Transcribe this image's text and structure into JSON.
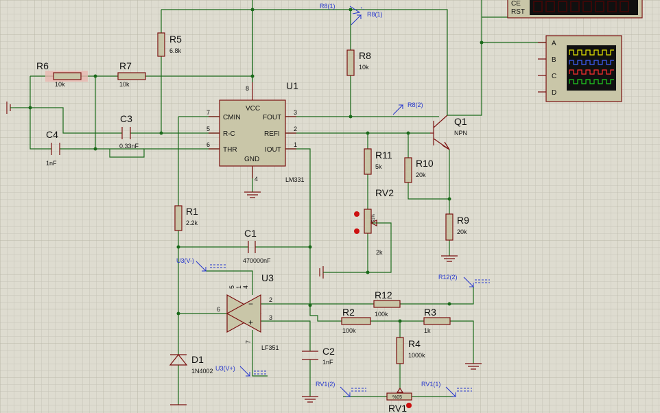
{
  "components": {
    "R5": {
      "ref": "R5",
      "value": "6.8k"
    },
    "R6": {
      "ref": "R6",
      "value": "10k"
    },
    "R7": {
      "ref": "R7",
      "value": "10k"
    },
    "R8": {
      "ref": "R8",
      "value": "10k"
    },
    "R1": {
      "ref": "R1",
      "value": "2.2k"
    },
    "R2": {
      "ref": "R2",
      "value": "100k"
    },
    "R3": {
      "ref": "R3",
      "value": "1k"
    },
    "R4": {
      "ref": "R4",
      "value": "1000k"
    },
    "R9": {
      "ref": "R9",
      "value": "20k"
    },
    "R10": {
      "ref": "R10",
      "value": "20k"
    },
    "R11": {
      "ref": "R11",
      "value": "5k"
    },
    "R12": {
      "ref": "R12",
      "value": "100k"
    },
    "C1": {
      "ref": "C1",
      "value": "470000nF"
    },
    "C2": {
      "ref": "C2",
      "value": "1nF"
    },
    "C3": {
      "ref": "C3",
      "value": "0.33nF"
    },
    "C4": {
      "ref": "C4",
      "value": "1nF"
    },
    "D1": {
      "ref": "D1",
      "value": "1N4002"
    },
    "Q1": {
      "ref": "Q1",
      "value": "NPN"
    },
    "RV2": {
      "ref": "RV2",
      "value": "2k",
      "setting": "51%"
    },
    "RV1": {
      "ref": "RV1",
      "setting": "%05"
    },
    "U1": {
      "ref": "U1",
      "part": "LM331",
      "pins": {
        "cmin": "CMIN",
        "rc": "R-C",
        "thr": "THR",
        "vcc": "VCC",
        "fout": "FOUT",
        "refi": "REFI",
        "iout": "IOUT",
        "gnd": "GND"
      },
      "pin_numbers": {
        "p7": "7",
        "p5": "5",
        "p6": "6",
        "p8": "8",
        "p3": "3",
        "p2": "2",
        "p1": "1",
        "p4": "4"
      }
    },
    "U3": {
      "ref": "U3",
      "part": "LF351",
      "pin_numbers": {
        "p6": "6",
        "p2": "2",
        "p3": "3",
        "p5": "5",
        "p1": "1",
        "p4": "4",
        "p7": "7"
      }
    }
  },
  "probes": {
    "r8_1_top": "R8(1)",
    "r8_1": "R8(1)",
    "r8_2": "R8(2)",
    "u3_vminus": "U3(V-)",
    "u3_vplus": "U3(V+)",
    "r12_2": "R12(2)",
    "rv1_2": "RV1(2)",
    "rv1_1": "RV1(1)"
  },
  "counter_pins": {
    "ce": "CE",
    "rst": "RST"
  },
  "oscilloscope": {
    "channels": [
      "A",
      "B",
      "C",
      "D"
    ],
    "trace_colors": [
      "#e8e800",
      "#4060ff",
      "#ff3030",
      "#20d020"
    ]
  },
  "colors": {
    "background": "#dedcd0",
    "grid": "#c7c5b7",
    "wire": "#1a6a1a",
    "component": "#7a1010",
    "component_fill": "#c9c6a8",
    "probe": "#2233cc"
  }
}
